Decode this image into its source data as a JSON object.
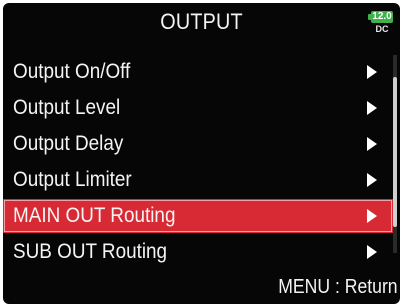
{
  "header": {
    "title": "OUTPUT",
    "battery": {
      "voltage": "12.0",
      "source": "DC",
      "color": "#3db24a"
    }
  },
  "menu": {
    "items": [
      {
        "label": "Output On/Off",
        "icon": "chevron-right-icon"
      },
      {
        "label": "Output Level",
        "icon": "chevron-right-icon"
      },
      {
        "label": "Output Delay",
        "icon": "chevron-right-icon"
      },
      {
        "label": "Output Limiter",
        "icon": "chevron-right-icon"
      },
      {
        "label": "MAIN OUT Routing",
        "icon": "chevron-right-icon",
        "selected": true
      },
      {
        "label": "SUB OUT Routing",
        "icon": "chevron-right-icon"
      }
    ],
    "highlight_color": "#d82a35"
  },
  "footer": {
    "hint": "MENU : Return"
  }
}
